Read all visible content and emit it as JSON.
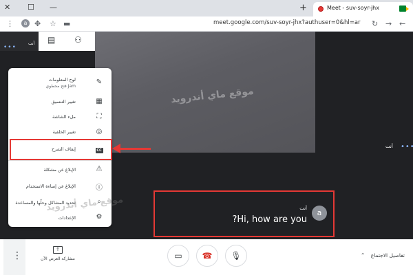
{
  "browser": {
    "tab_title": "Meet - suv-soyr-jhx",
    "new_tab_icon": "plus-icon",
    "url": "meet.google.com/suv-soyr-jhx?authuser=0&hl=ar",
    "profile_initial": "a"
  },
  "meeting": {
    "self_label": "أنت",
    "watermark": "موقع ماي أندرويد"
  },
  "menu": {
    "items": [
      {
        "label": "لوح المعلومات",
        "sublabel": "فتح محطوي Jam",
        "icon": "pencil-icon"
      },
      {
        "label": "تغيير التنسيق",
        "icon": "layout-icon"
      },
      {
        "label": "ملء الشاشة",
        "icon": "fullscreen-icon"
      },
      {
        "label": "تغيير الخلفية",
        "icon": "background-icon"
      },
      {
        "label": "إيقاف الشرح",
        "icon": "captions-icon",
        "badge": "CC"
      },
      {
        "label": "الإبلاغ عن مشكلة",
        "icon": "report-icon"
      },
      {
        "label": "الإبلاغ عن إساءة الاستخدام",
        "icon": "abuse-icon"
      },
      {
        "label": "تحديد المشاكل وحلّها والمساعدة",
        "icon": "troubleshoot-icon"
      },
      {
        "label": "الإعدادات",
        "icon": "settings-icon"
      }
    ]
  },
  "caption": {
    "speaker": "أنت",
    "text": "?Hi, how are you",
    "avatar_initial": "a"
  },
  "bottombar": {
    "present_label": "مشاركة العرض الآن",
    "details_label": "تفاصيل الاجتماع"
  },
  "colors": {
    "highlight": "#e53935",
    "meet_bg": "#202124"
  }
}
